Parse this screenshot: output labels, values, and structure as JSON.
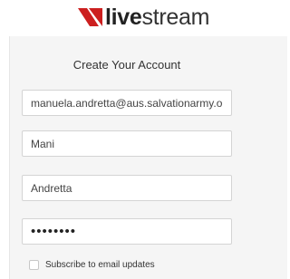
{
  "brand": {
    "name_bold": "live",
    "name_light": "stream",
    "accent_color": "#cc1f1f"
  },
  "form": {
    "title": "Create Your Account",
    "email_value": "manuela.andretta@aus.salvationarmy.or",
    "first_name_value": "Mani",
    "last_name_value": "Andretta",
    "password_masked": "••••••••",
    "subscribe_label": "Subscribe to email updates",
    "subscribe_checked": false
  }
}
